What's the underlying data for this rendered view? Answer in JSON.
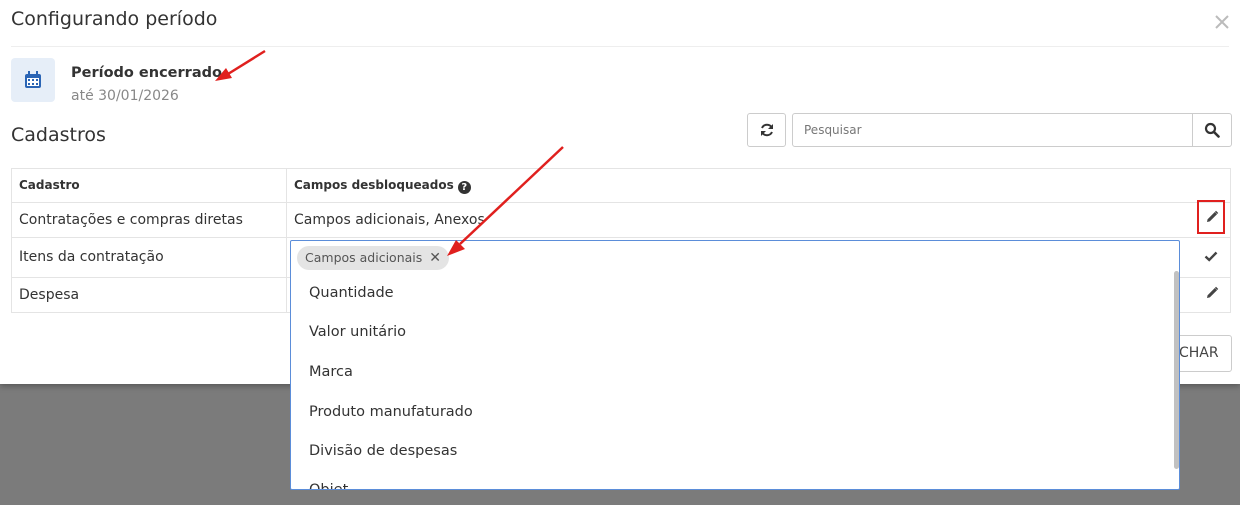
{
  "modal": {
    "title": "Configurando período",
    "period": {
      "title": "Período encerrado",
      "subtitle": "até 30/01/2026"
    },
    "section_title": "Cadastros",
    "search": {
      "placeholder": "Pesquisar"
    },
    "table": {
      "headers": {
        "cadastro": "Cadastro",
        "campos": "Campos desbloqueados"
      },
      "rows": [
        {
          "cadastro": "Contratações e compras diretas",
          "campos": "Campos adicionais, Anexos",
          "action": "pencil-icon"
        },
        {
          "cadastro": "Itens da contratação",
          "campos": "",
          "action": "check-icon"
        },
        {
          "cadastro": "Despesa",
          "campos": "",
          "action": "pencil-icon"
        }
      ]
    },
    "close_button_visible_text": "CHAR"
  },
  "dropdown": {
    "selected_tag": "Campos adicionais",
    "options": [
      "Quantidade",
      "Valor unitário",
      "Marca",
      "Produto manufaturado",
      "Divisão de despesas",
      "Objet"
    ]
  },
  "colors": {
    "accent": "#5b8dd9",
    "annotation": "#e0201e",
    "calendar": "#2b65b5"
  }
}
